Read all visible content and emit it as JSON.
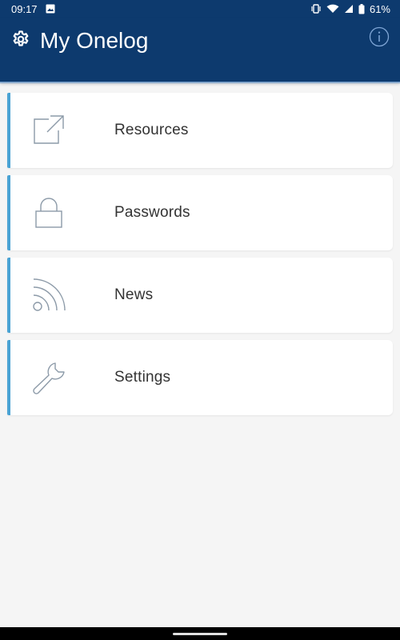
{
  "status_bar": {
    "time": "09:17",
    "battery": "61%"
  },
  "header": {
    "title": "My Onelog",
    "left_icon": "gear-icon",
    "right_icon": "info-icon",
    "background_color": "#0d3a6e"
  },
  "menu": {
    "accent_color": "#4aa3d4",
    "items": [
      {
        "label": "Resources",
        "icon": "external-link-icon"
      },
      {
        "label": "Passwords",
        "icon": "lock-icon"
      },
      {
        "label": "News",
        "icon": "rss-icon"
      },
      {
        "label": "Settings",
        "icon": "wrench-icon"
      }
    ]
  }
}
